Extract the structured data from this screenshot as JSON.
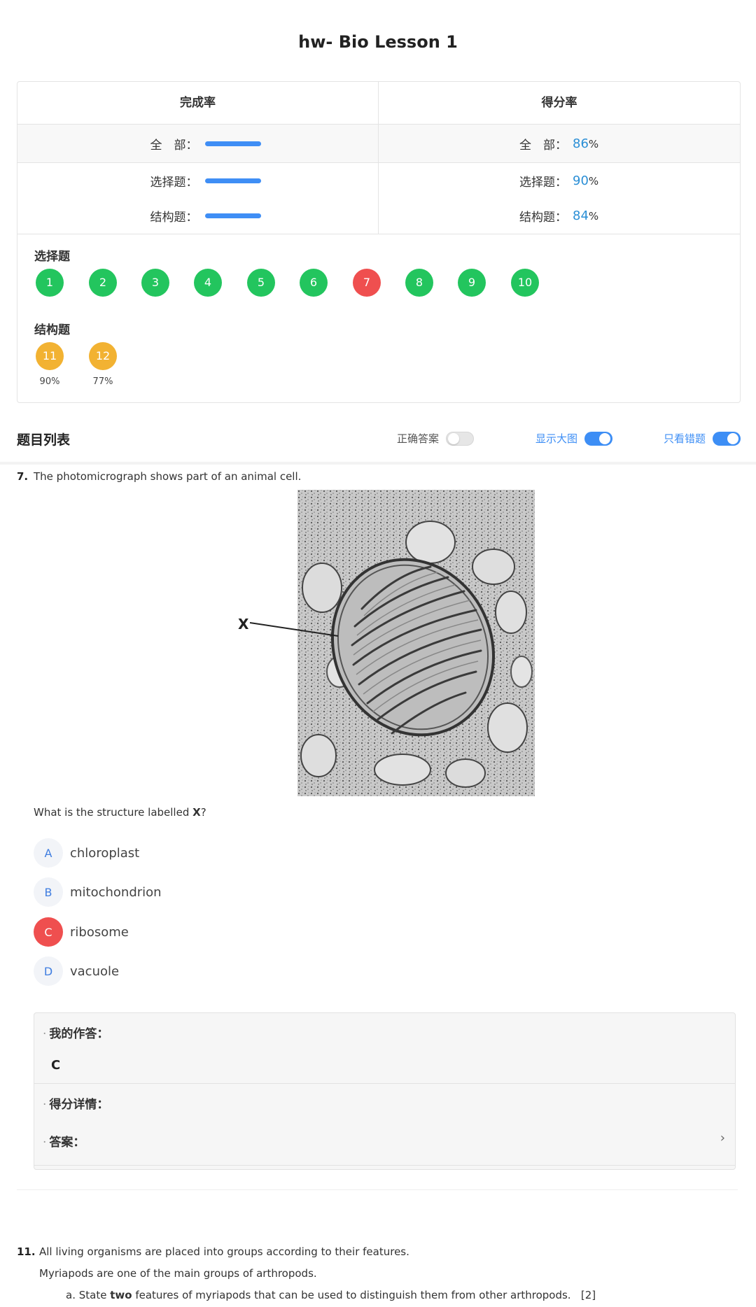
{
  "title": "hw- Bio Lesson 1",
  "stats": {
    "completion": {
      "header": "完成率",
      "rows": [
        {
          "label": "全　部：",
          "progress": 1.0
        },
        {
          "label": "选择题：",
          "progress": 1.0
        },
        {
          "label": "结构题：",
          "progress": 1.0
        }
      ]
    },
    "score": {
      "header": "得分率",
      "rows": [
        {
          "label": "全　部：",
          "value": "86",
          "unit": "%"
        },
        {
          "label": "选择题：",
          "value": "90",
          "unit": "%"
        },
        {
          "label": "结构题：",
          "value": "84",
          "unit": "%"
        }
      ]
    }
  },
  "mcq": {
    "label": "选择题",
    "questions": [
      {
        "num": "1",
        "status": "correct"
      },
      {
        "num": "2",
        "status": "correct"
      },
      {
        "num": "3",
        "status": "correct"
      },
      {
        "num": "4",
        "status": "correct"
      },
      {
        "num": "5",
        "status": "correct"
      },
      {
        "num": "6",
        "status": "correct"
      },
      {
        "num": "7",
        "status": "wrong"
      },
      {
        "num": "8",
        "status": "correct"
      },
      {
        "num": "9",
        "status": "correct"
      },
      {
        "num": "10",
        "status": "correct"
      }
    ]
  },
  "structured": {
    "label": "结构题",
    "questions": [
      {
        "num": "11",
        "score": "90%"
      },
      {
        "num": "12",
        "score": "77%"
      }
    ]
  },
  "list": {
    "title": "题目列表",
    "toggles": {
      "correct_answer": {
        "label": "正确答案",
        "on": false
      },
      "show_large": {
        "label": "显示大图",
        "on": true
      },
      "wrong_only": {
        "label": "只看错题",
        "on": true
      }
    }
  },
  "q7": {
    "number": "7.",
    "text": "The photomicrograph shows part of an animal cell.",
    "figure_label": "X",
    "prompt_pre": "What is the structure labelled ",
    "prompt_bold": "X",
    "prompt_post": "?",
    "options": [
      {
        "letter": "A",
        "text": "chloroplast",
        "selected_wrong": false
      },
      {
        "letter": "B",
        "text": "mitochondrion",
        "selected_wrong": false
      },
      {
        "letter": "C",
        "text": "ribosome",
        "selected_wrong": true
      },
      {
        "letter": "D",
        "text": "vacuole",
        "selected_wrong": false
      }
    ],
    "my_answer_label": "我的作答：",
    "my_answer": "C",
    "score_detail_label": "得分详情：",
    "answer_label": "答案："
  },
  "q11": {
    "number": "11.",
    "text": "All living organisms are placed into groups according to their features.",
    "sub": "Myriapods are one of the main groups of arthropods.",
    "part_a_letter": "a.",
    "part_a_pre": "State ",
    "part_a_bold": "two",
    "part_a_post": " features of myriapods that can be used to distinguish them from other arthropods.",
    "part_a_marks": "[2]"
  },
  "colors": {
    "correct": "#23c55e",
    "wrong": "#ef4f4f",
    "structured": "#f2b232",
    "accent": "#3d8ef5",
    "score_number": "#2b8fd6"
  }
}
